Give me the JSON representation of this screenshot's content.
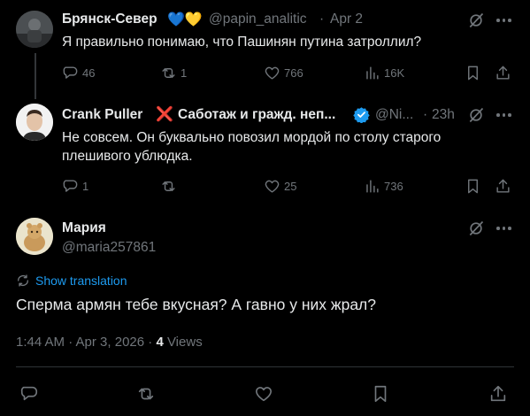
{
  "tweet1": {
    "author": "Брянск-Север",
    "emoji": "💙💛",
    "handle": "@papin_analitic",
    "sep": "·",
    "time": "Apr 2",
    "text": "Я правильно понимаю, что Пашинян путина затроллил?",
    "replies": "46",
    "retweets": "1",
    "likes": "766",
    "views": "16K"
  },
  "tweet2": {
    "author": "Crank Puller",
    "cross": "❌",
    "author_suffix": "Саботаж и гражд. неп...",
    "handle": "@Ni...",
    "sep": "·",
    "time": "23h",
    "text": "Не совсем. Он буквально повозил мордой по столу старого плешивого ублюдка.",
    "replies": "1",
    "retweets": "",
    "likes": "25",
    "views": "736"
  },
  "tweet3": {
    "author": "Мария",
    "handle": "@maria257861",
    "translate": "Show translation",
    "text": "Сперма армян тебе вкусная? А гавно у них жрал?",
    "timestamp": "1:44 AM · Apr 3, 2026 · ",
    "views_count": "4",
    "views_label": "Views"
  },
  "colors": {
    "accent": "#1d9bf0",
    "muted": "#71767b",
    "background": "#000000",
    "text": "#e7e9ea"
  },
  "icons": [
    "reply-icon",
    "retweet-icon",
    "like-icon",
    "views-icon",
    "bookmark-icon",
    "share-icon",
    "grok-icon",
    "more-icon",
    "verified-icon",
    "translate-icon"
  ]
}
